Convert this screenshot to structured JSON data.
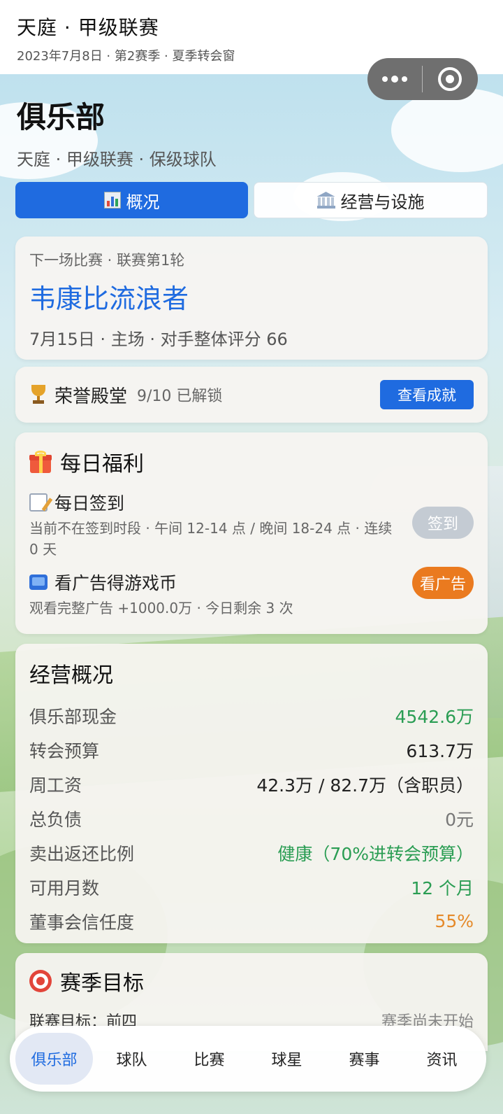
{
  "header": {
    "title": "天庭 · 甲级联赛",
    "subtitle": "2023年7月8日 · 第2赛季 · 夏季转会窗"
  },
  "page": {
    "title": "俱乐部",
    "subtitle": "天庭 · 甲级联赛 · 保级球队"
  },
  "tabs": [
    {
      "label": "概况",
      "icon": "bar-chart-icon",
      "active": true
    },
    {
      "label": "经营与设施",
      "icon": "bank-icon",
      "active": false
    }
  ],
  "next_match": {
    "label": "下一场比赛 · 联赛第1轮",
    "opponent": "韦康比流浪者",
    "meta": "7月15日 · 主场 · 对手整体评分 66"
  },
  "hall_of_fame": {
    "name": "荣誉殿堂",
    "status": "9/10 已解锁",
    "button": "查看成就"
  },
  "daily": {
    "title": "每日福利",
    "checkin": {
      "title": "每日签到",
      "desc": "当前不在签到时段 · 午间 12-14 点 / 晚间 18-24 点 · 连续 0 天",
      "button": "签到"
    },
    "ad": {
      "title": "看广告得游戏币",
      "desc": "观看完整广告 +1000.0万 · 今日剩余 3 次",
      "button": "看广告"
    }
  },
  "operations": {
    "title": "经营概况",
    "rows": [
      {
        "label": "俱乐部现金",
        "value": "4542.6万",
        "color": "#2a9d53"
      },
      {
        "label": "转会预算",
        "value": "613.7万",
        "color": "#222222"
      },
      {
        "label": "周工资",
        "value": "42.3万 / 82.7万（含职员）",
        "color": "#222222"
      },
      {
        "label": "总负债",
        "value": "0元",
        "color": "#777777"
      },
      {
        "label": "卖出返还比例",
        "value": "健康（70%进转会预算）",
        "color": "#2a9d53"
      },
      {
        "label": "可用月数",
        "value": "12 个月",
        "color": "#2a9d53"
      },
      {
        "label": "董事会信任度",
        "value": "55%",
        "color": "#e58a2a"
      }
    ]
  },
  "goals": {
    "title": "赛季目标",
    "line_label": "联赛目标：前四",
    "line_status": "赛季尚未开始"
  },
  "nav": [
    "俱乐部",
    "球队",
    "比赛",
    "球星",
    "赛事",
    "资讯"
  ],
  "colors": {
    "accent": "#1f6be0",
    "orange": "#ea7a1f",
    "green": "#2a9d53"
  }
}
